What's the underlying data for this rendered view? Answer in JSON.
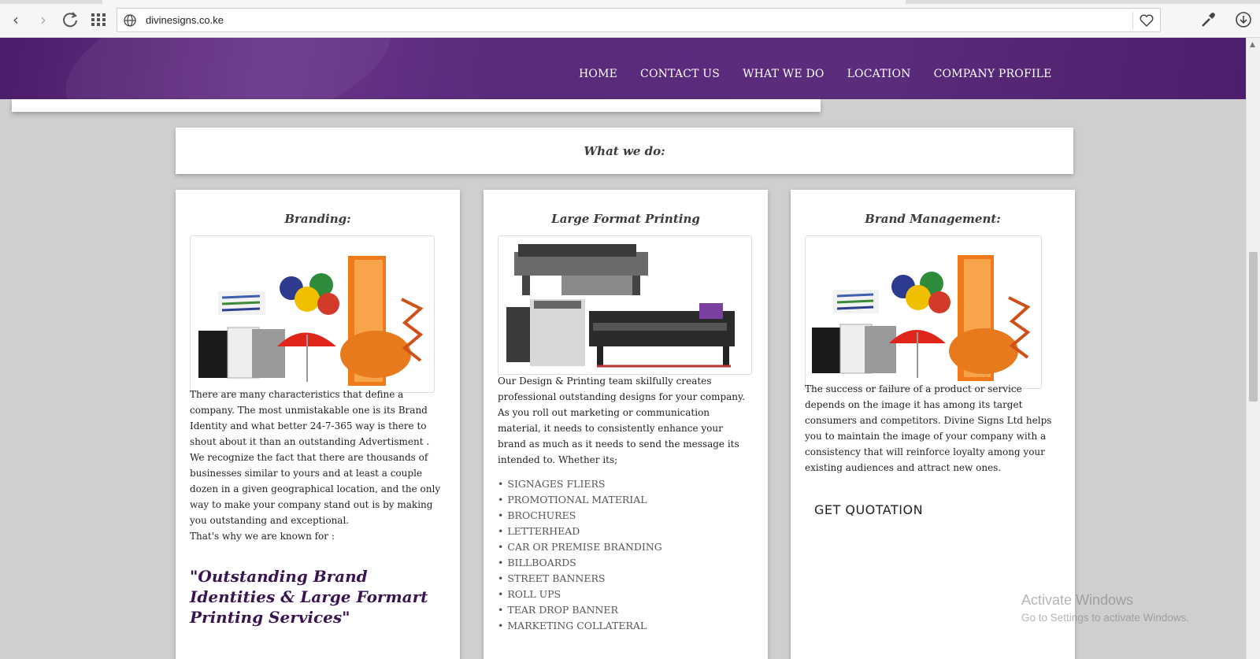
{
  "browser": {
    "url": "divinesigns.co.ke"
  },
  "nav": {
    "items": [
      "HOME",
      "CONTACT US",
      "WHAT WE DO",
      "LOCATION",
      "COMPANY PROFILE"
    ]
  },
  "section_title": "What we do:",
  "cards": [
    {
      "title": "Branding:",
      "body": [
        "There are many characteristics that define a company. The most unmistakable one is its Brand Identity and what better 24-7-365 way is there to shout about it than an outstanding Advertisment . We recognize the fact that there are thousands of businesses similar to yours and at least a couple dozen in a given geographical location, and the only way to make your company stand out is by making you outstanding and exceptional.",
        "That's why we are known for :"
      ],
      "quote": "\"Outstanding Brand Identities & Large Formart Printing Services\""
    },
    {
      "title": "Large Format Printing",
      "body": "Our Design & Printing team skilfully creates professional outstanding designs for your company. As you roll out marketing or communication material, it needs to consistently enhance your brand as much as it needs to send the message its intended to. Whether its;",
      "list": [
        "SIGNAGES FLIERS",
        "PROMOTIONAL MATERIAL",
        "BROCHURES",
        "LETTERHEAD",
        "CAR OR PREMISE BRANDING",
        "BILLBOARDS",
        "STREET BANNERS",
        "ROLL UPS",
        "TEAR DROP BANNER",
        "MARKETING COLLATERAL"
      ]
    },
    {
      "title": "Brand Management:",
      "body": "The success or failure of a product or service depends on the image it has among its target consumers and competitors. Divine Signs Ltd helps you to maintain the image of your company with a consistency that will reinforce loyalty among your existing audiences and attract new ones.",
      "button": "GET QUOTATION"
    }
  ],
  "watermark": {
    "line1": "Activate Windows",
    "line2": "Go to Settings to activate Windows."
  },
  "colors": {
    "header_purple": "#5b2b7c",
    "quote_purple": "#3a1450",
    "page_bg": "#cfcfcf"
  }
}
